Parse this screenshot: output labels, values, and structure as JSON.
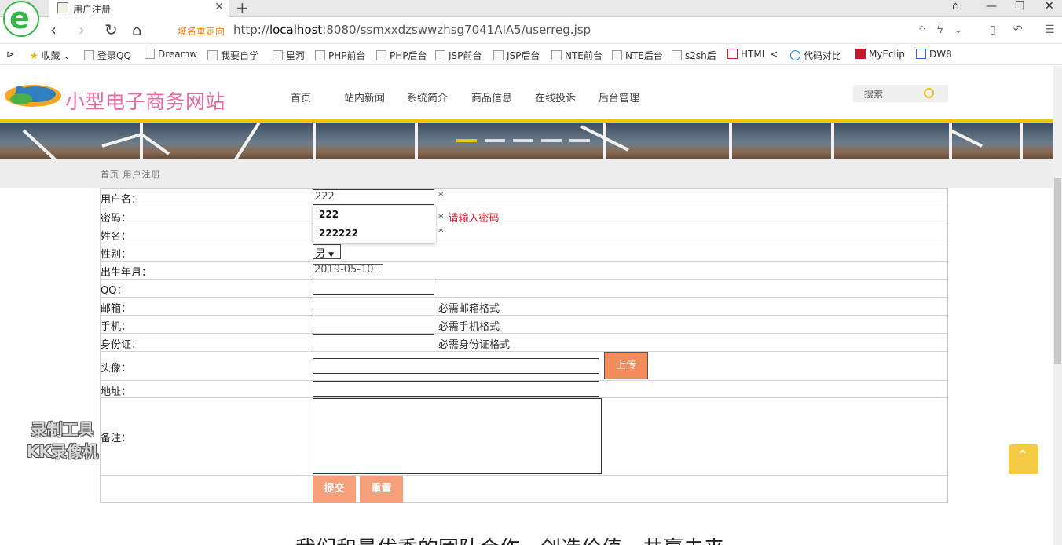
{
  "browser": {
    "tab_title": "用户注册",
    "tab_close": "✕",
    "new_tab": "+",
    "addr_tag": "域名重定向",
    "url_prefix": "http://",
    "url_host": "localhost",
    "url_rest": ":8080/ssmxxdzswwzhsg7041AIA5/userreg.jsp"
  },
  "bookmarks": [
    {
      "label": "收藏"
    },
    {
      "label": "登录QQ"
    },
    {
      "label": "Dreamw"
    },
    {
      "label": "我要自学"
    },
    {
      "label": "星河"
    },
    {
      "label": "PHP前台"
    },
    {
      "label": "PHP后台"
    },
    {
      "label": "JSP前台"
    },
    {
      "label": "JSP后台"
    },
    {
      "label": "NTE前台"
    },
    {
      "label": "NTE后台"
    },
    {
      "label": "s2sh后"
    },
    {
      "label": "HTML <"
    },
    {
      "label": "代码对比"
    },
    {
      "label": "MyEclip"
    },
    {
      "label": "DW8"
    }
  ],
  "site": {
    "name": "小型电子商务网站",
    "menu": [
      "首页",
      "站内新闻",
      "系统简介",
      "商品信息",
      "在线投诉",
      "后台管理"
    ],
    "search_placeholder": "搜索",
    "breadcrumb": "首页 用户注册"
  },
  "form": {
    "username_label": "用户名：",
    "username_value": "222",
    "username_star": "*",
    "password_label": "密码：",
    "password_star": "*",
    "password_error": "请输入密码",
    "name_label": "姓名：",
    "name_star": "*",
    "gender_label": "性别：",
    "gender_value": "男",
    "birth_label": "出生年月：",
    "birth_value": "2019-05-10",
    "qq_label": "QQ：",
    "email_label": "邮箱：",
    "email_hint": "必需邮箱格式",
    "phone_label": "手机：",
    "phone_hint": "必需手机格式",
    "id_label": "身份证：",
    "id_hint": "必需身份证格式",
    "avatar_label": "头像：",
    "upload_button": "上传",
    "address_label": "地址：",
    "remark_label": "备注：",
    "submit_button": "提交",
    "reset_button": "重置"
  },
  "autocomplete": [
    "222",
    "222222"
  ],
  "watermark": {
    "line1": "录制工具",
    "line2": "KK录像机"
  },
  "slogan": "我们和最优秀的团队合作，创造价值，共赢未来",
  "colors": {
    "accent": "#e8c800",
    "site_name": "#e86a9e",
    "button": "#f5a07a",
    "error": "#d0142a"
  }
}
